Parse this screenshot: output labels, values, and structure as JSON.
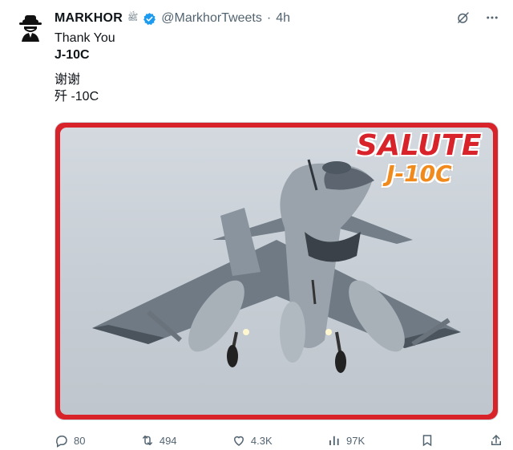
{
  "author": {
    "name": "MARKHOR",
    "affiliation_glyph": "ﷺ",
    "handle": "@MarkhorTweets",
    "separator": "·",
    "time": "4h"
  },
  "tweet": {
    "lines": [
      "Thank You",
      "J-10C",
      "谢谢",
      "歼 -10C"
    ]
  },
  "media": {
    "overlay_title": "SALUTE",
    "overlay_subtitle": "J-10C"
  },
  "actions": {
    "replies": "80",
    "reposts": "494",
    "likes": "4.3K",
    "views": "97K"
  },
  "colors": {
    "accent_blue": "#1d9bf0",
    "text_secondary": "#536471",
    "frame_red": "#d8232a",
    "subtitle_orange": "#f08a1c"
  },
  "icons": [
    "spy-avatar-icon",
    "verified-badge-icon",
    "grok-icon",
    "more-icon",
    "reply-icon",
    "repost-icon",
    "like-icon",
    "views-icon",
    "bookmark-icon"
  ]
}
